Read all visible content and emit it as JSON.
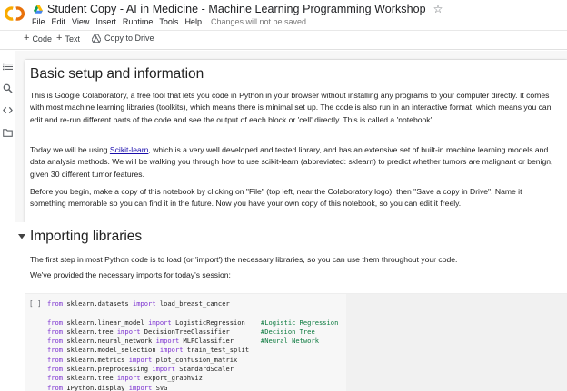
{
  "app": {
    "doc_title": "Student Copy - AI in Medicine - Machine Learning Programming Workshop",
    "menu": [
      "File",
      "Edit",
      "View",
      "Insert",
      "Runtime",
      "Tools",
      "Help"
    ],
    "save_status": "Changes will not be saved",
    "logo_text": "CO",
    "colors": {
      "logo_orange": "#f9ab00",
      "logo_dark_orange": "#e8710a",
      "link": "#1a0dab",
      "keyword": "#7b30d0",
      "comment": "#0b7a3e"
    }
  },
  "toolbar": {
    "add_code": "Code",
    "add_text": "Text",
    "copy_to_drive": "Copy to Drive"
  },
  "sidebar": {
    "icons": [
      "table-of-contents-icon",
      "search-icon",
      "code-snippets-icon",
      "files-icon"
    ]
  },
  "text_cell": {
    "heading": "Basic setup and information",
    "p1": "This is Google Colaboratory, a free tool that lets you code in Python in your browser without installing any programs to your computer directly. It comes with most machine learning libraries (toolkits), which means there is minimal set up. The code is also run in an interactive format, which means you can edit and re-run different parts of the code and see the output of each block or 'cell' directly. This is called a 'notebook'.",
    "p2_before": "Today we will be using ",
    "p2_link": "Scikit-learn",
    "p2_after": ", which is a very well developed and tested library, and has an extensive set of built-in machine learning models and data analysis methods. We will be walking you through how to use scikit-learn (abbreviated: sklearn) to predict whether tumors are malignant or benign, given 30 different tumor features.",
    "p3": "Before you begin, make a copy of this notebook by clicking on \"File\" (top left, near the Colaboratory logo), then \"Save a copy in Drive\". Name it something memorable so you can find it in the future. Now you have your own copy of this notebook, so you can edit it freely."
  },
  "section": {
    "heading": "Importing libraries",
    "p1": "The first step in most Python code is to load (or 'import') the necessary libraries, so you can use them throughout your code.",
    "p2": "We've provided the necessary imports for today's session:"
  },
  "code_cell": {
    "run_label": "[ ]",
    "lines": [
      {
        "kw1": "from",
        "mod": " sklearn.datasets ",
        "kw2": "import",
        "name": " load_breast_cancer",
        "pad": "",
        "comment": ""
      },
      {
        "kw1": "",
        "mod": "",
        "kw2": "",
        "name": "",
        "pad": "",
        "comment": ""
      },
      {
        "kw1": "from",
        "mod": " sklearn.linear_model ",
        "kw2": "import",
        "name": " LogisticRegression",
        "pad": "    ",
        "comment": "#Logistic Regression"
      },
      {
        "kw1": "from",
        "mod": " sklearn.tree ",
        "kw2": "import",
        "name": " DecisionTreeClassifier",
        "pad": "        ",
        "comment": "#Decision Tree"
      },
      {
        "kw1": "from",
        "mod": " sklearn.neural_network ",
        "kw2": "import",
        "name": " MLPClassifier",
        "pad": "       ",
        "comment": "#Neural Network"
      },
      {
        "kw1": "from",
        "mod": " sklearn.model_selection ",
        "kw2": "import",
        "name": " train_test_split",
        "pad": "",
        "comment": ""
      },
      {
        "kw1": "from",
        "mod": " sklearn.metrics ",
        "kw2": "import",
        "name": " plot_confusion_matrix",
        "pad": "",
        "comment": ""
      },
      {
        "kw1": "from",
        "mod": " sklearn.preprocessing ",
        "kw2": "import",
        "name": " StandardScaler",
        "pad": "",
        "comment": ""
      },
      {
        "kw1": "from",
        "mod": " sklearn.tree ",
        "kw2": "import",
        "name": " export_graphviz",
        "pad": "",
        "comment": ""
      },
      {
        "kw1": "from",
        "mod": " IPython.display ",
        "kw2": "import",
        "name": " SVG",
        "pad": "",
        "comment": ""
      }
    ]
  }
}
